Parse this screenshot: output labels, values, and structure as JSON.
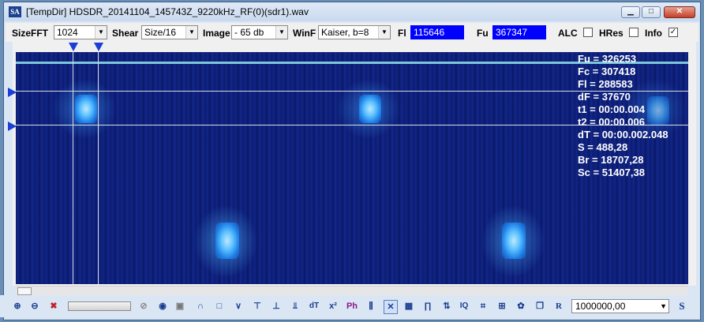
{
  "window": {
    "app_icon": "SA",
    "title": "[TempDir] HDSDR_20141104_145743Z_9220kHz_RF(0)(sdr1).wav",
    "minimize_icon": "minimize-icon",
    "maximize_icon": "maximize-icon",
    "close_icon": "close-icon"
  },
  "toolbar": {
    "sizefft_label": "SizeFFT",
    "sizefft_value": "1024",
    "shear_label": "Shear",
    "shear_value": "Size/16",
    "image_label": "Image",
    "image_value": "- 65 db",
    "winf_label": "WinF",
    "winf_value": "Kaiser, b=8",
    "fl_label": "Fl",
    "fl_value": "115646",
    "fu_label": "Fu",
    "fu_value": "367347",
    "alc_label": "ALC",
    "alc_checked": false,
    "hres_label": "HRes",
    "hres_checked": false,
    "info_label": "Info",
    "info_checked": true
  },
  "info_overlay": [
    "Fu = 326253",
    "Fc = 307418",
    "Fl = 288583",
    "dF = 37670",
    "t1 = 00:00.004",
    "t2 = 00:00.006",
    "dT = 00:00.002.048",
    "S = 488,28",
    "Br = 18707,28",
    "Sc = 51407,38"
  ],
  "bottom": {
    "rate_value": "1000000,00",
    "s_button": "S",
    "dt_button": "dT",
    "iq_button": "IQ",
    "r_button": "R"
  },
  "colors": {
    "spectrum_bg": "#0d1e78",
    "signal": "#5fc3ff",
    "readout_box": "#0000ff",
    "cursor_marker": "#1a3fd6"
  }
}
